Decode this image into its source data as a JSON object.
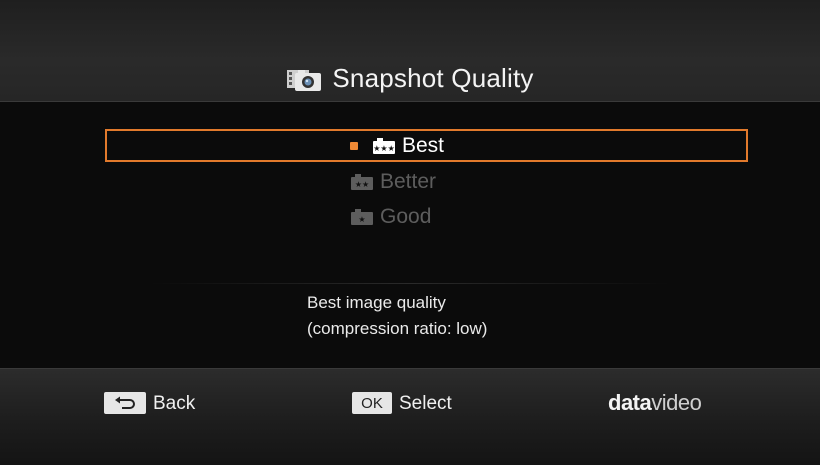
{
  "header": {
    "title": "Snapshot Quality",
    "icon": "camera-film-icon"
  },
  "options": [
    {
      "label": "Best",
      "icon": "three-star-camera-icon",
      "selected": true
    },
    {
      "label": "Better",
      "icon": "two-star-camera-icon",
      "selected": false
    },
    {
      "label": "Good",
      "icon": "one-star-camera-icon",
      "selected": false
    }
  ],
  "description": {
    "line1": "Best image quality",
    "line2": "(compression ratio: low)"
  },
  "footer": {
    "back_key": "⮌",
    "back_label": "Back",
    "ok_key": "OK",
    "select_label": "Select",
    "brand_bold": "data",
    "brand_thin": "video"
  },
  "colors": {
    "accent": "#e27a2c",
    "dim_text": "#5d5d5d"
  }
}
